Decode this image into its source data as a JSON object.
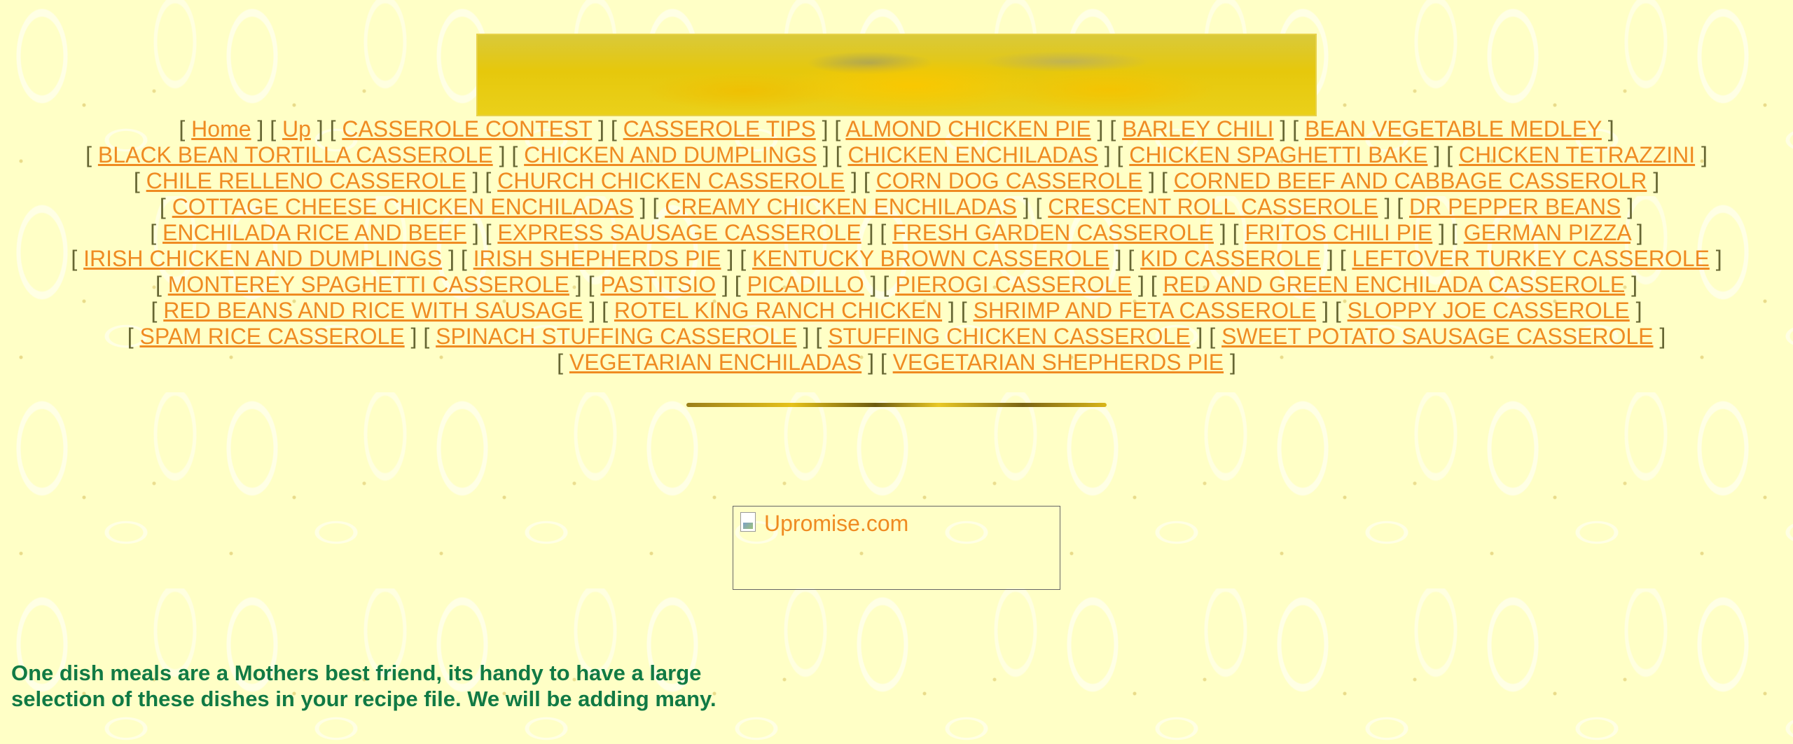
{
  "nav_rows": [
    [
      "Home",
      "Up",
      "CASSEROLE CONTEST",
      "CASSEROLE TIPS",
      "ALMOND CHICKEN PIE",
      "BARLEY CHILI",
      "BEAN VEGETABLE MEDLEY"
    ],
    [
      "BLACK BEAN TORTILLA CASSEROLE",
      "CHICKEN AND DUMPLINGS",
      "CHICKEN ENCHILADAS",
      "CHICKEN SPAGHETTI BAKE",
      "CHICKEN TETRAZZINI"
    ],
    [
      "CHILE RELLENO CASSEROLE",
      "CHURCH CHICKEN CASSEROLE",
      "CORN DOG CASSEROLE",
      "CORNED BEEF AND CABBAGE CASSEROLR"
    ],
    [
      "COTTAGE CHEESE CHICKEN ENCHILADAS",
      "CREAMY CHICKEN ENCHILADAS",
      "CRESCENT ROLL CASSEROLE",
      "DR PEPPER BEANS"
    ],
    [
      "ENCHILADA RICE AND BEEF",
      "EXPRESS SAUSAGE CASSEROLE",
      "FRESH GARDEN CASSEROLE",
      "FRITOS CHILI PIE",
      "GERMAN PIZZA"
    ],
    [
      "IRISH CHICKEN AND DUMPLINGS",
      "IRISH SHEPHERDS PIE",
      "KENTUCKY BROWN CASSEROLE",
      "KID CASSEROLE",
      "LEFTOVER TURKEY CASSEROLE"
    ],
    [
      "MONTEREY SPAGHETTI CASSEROLE",
      "PASTITSIO",
      "PICADILLO",
      "PIEROGI CASSEROLE",
      "RED AND GREEN ENCHILADA CASSEROLE"
    ],
    [
      "RED BEANS AND RICE WITH SAUSAGE",
      "ROTEL KING RANCH CHICKEN",
      "SHRIMP AND FETA CASSEROLE",
      "SLOPPY JOE CASSEROLE"
    ],
    [
      "SPAM RICE CASSEROLE",
      "SPINACH STUFFING CASSEROLE",
      "STUFFING CHICKEN CASSEROLE",
      "SWEET POTATO SAUSAGE CASSEROLE"
    ],
    [
      "VEGETARIAN ENCHILADAS",
      "VEGETARIAN SHEPHERDS PIE"
    ]
  ],
  "ad": {
    "link_text": "Upromise.com",
    "icon": "broken-image-icon"
  },
  "tagline": {
    "line1": "One dish meals are a Mothers best friend, its handy to have a large",
    "line2": "selection of these dishes in your recipe file.  We will be adding many."
  },
  "colors": {
    "link": "#ef8b22",
    "tagline": "#117a44",
    "background": "#ffffc6"
  }
}
